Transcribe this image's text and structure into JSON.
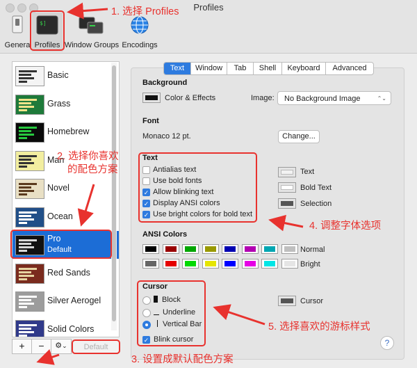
{
  "window": {
    "title": "Profiles"
  },
  "toolbar": {
    "items": [
      {
        "label": "Genera"
      },
      {
        "label": "Profiles"
      },
      {
        "label": "Window Groups"
      },
      {
        "label": "Encodings"
      }
    ]
  },
  "sidebar": {
    "profiles": [
      {
        "name": "Basic",
        "bg": "#f4f4f4",
        "fg": "#333333"
      },
      {
        "name": "Grass",
        "bg": "#1e7a3a",
        "fg": "#f1e38a"
      },
      {
        "name": "Homebrew",
        "bg": "#0a0a0a",
        "fg": "#27c93f"
      },
      {
        "name": "Man",
        "bg": "#f2eea0",
        "fg": "#333333"
      },
      {
        "name": "Novel",
        "bg": "#e9e0c5",
        "fg": "#5a3a1e"
      },
      {
        "name": "Ocean",
        "bg": "#214f88",
        "fg": "#ffffff"
      },
      {
        "name": "Pro",
        "sub": "Default",
        "bg": "#111111",
        "fg": "#d8d8d8"
      },
      {
        "name": "Red Sands",
        "bg": "#7a2b1e",
        "fg": "#e6d3a1"
      },
      {
        "name": "Silver Aerogel",
        "bg": "#9c9c9c",
        "fg": "#ffffff"
      },
      {
        "name": "Solid Colors",
        "bg": "#303a8a",
        "fg": "#ffffff"
      }
    ],
    "add_label": "+",
    "remove_label": "−",
    "gear_label": "⚙",
    "chevron_label": "⌄",
    "default_label": "Default"
  },
  "tabs": [
    "Text",
    "Window",
    "Tab",
    "Shell",
    "Keyboard",
    "Advanced"
  ],
  "background": {
    "title": "Background",
    "color_effects": "Color & Effects",
    "image_label": "Image:",
    "image_value": "No Background Image"
  },
  "font": {
    "title": "Font",
    "value": "Monaco 12 pt.",
    "change_label": "Change..."
  },
  "text": {
    "title": "Text",
    "options": [
      {
        "label": "Antialias text",
        "checked": false
      },
      {
        "label": "Use bold fonts",
        "checked": false
      },
      {
        "label": "Allow blinking text",
        "checked": true
      },
      {
        "label": "Display ANSI colors",
        "checked": true
      },
      {
        "label": "Use bright colors for bold text",
        "checked": true
      }
    ],
    "color_labels": [
      "Text",
      "Bold Text",
      "Selection"
    ],
    "check_glyph": "✓"
  },
  "ansi": {
    "title": "ANSI Colors",
    "normal_label": "Normal",
    "bright_label": "Bright",
    "normal": [
      "#000000",
      "#990000",
      "#00a600",
      "#999900",
      "#0000b2",
      "#b200b2",
      "#00a6b2",
      "#bfbfbf"
    ],
    "bright": [
      "#666666",
      "#e50000",
      "#00d900",
      "#e5e500",
      "#0000ff",
      "#e500e5",
      "#00e5e5",
      "#e5e5e5"
    ]
  },
  "cursor": {
    "title": "Cursor",
    "block_label": "Block",
    "underline_label": "Underline",
    "bar_label": "Vertical Bar",
    "blink_label": "Blink cursor",
    "color_label": "Cursor",
    "selected": "Vertical Bar"
  },
  "help_label": "?",
  "annotations": {
    "step1": "1. 选择 Profiles",
    "step2a": "2. 选择你喜欢",
    "step2b": "的配色方案",
    "step3": "3. 设置成默认配色方案",
    "step4": "4. 调整字体选项",
    "step5": "5. 选择喜欢的游标样式"
  },
  "colors": {
    "accent": "#2e7bdf",
    "selection": "#1c6dd6",
    "annotation": "#e8322e"
  }
}
